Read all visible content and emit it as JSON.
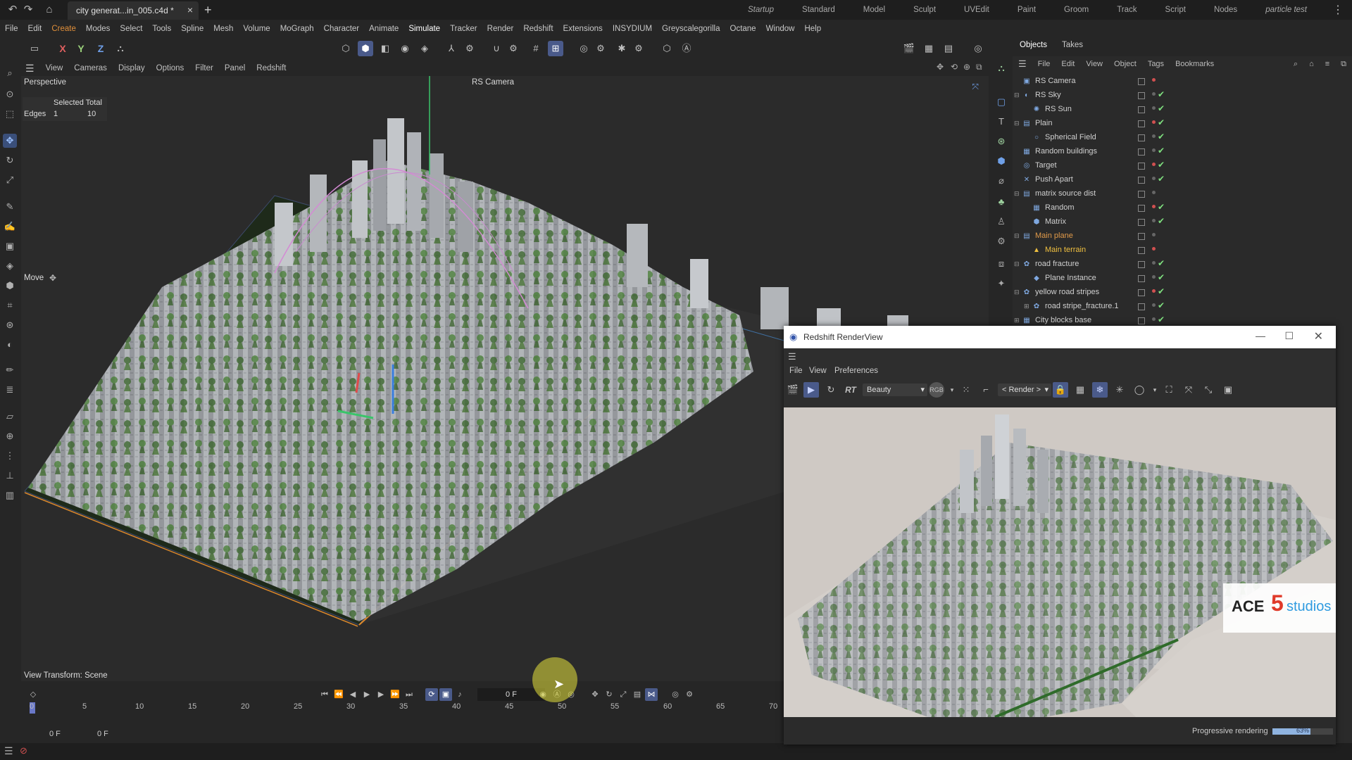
{
  "titlebar": {
    "doc_tab": "city generat...in_005.c4d *",
    "layouts": [
      "Startup",
      "Standard",
      "Model",
      "Sculpt",
      "UVEdit",
      "Paint",
      "Groom",
      "Track",
      "Script",
      "Nodes",
      "particle test"
    ]
  },
  "menubar": [
    "File",
    "Edit",
    "Create",
    "Modes",
    "Select",
    "Tools",
    "Spline",
    "Mesh",
    "Volume",
    "MoGraph",
    "Character",
    "Animate",
    "Simulate",
    "Tracker",
    "Render",
    "Redshift",
    "Extensions",
    "INSYDIUM",
    "Greyscalegorilla",
    "Octane",
    "Window",
    "Help"
  ],
  "cmdbar": {
    "axis_x": "X",
    "axis_y": "Y",
    "axis_z": "Z"
  },
  "viewport": {
    "menu": [
      "View",
      "Cameras",
      "Display",
      "Options",
      "Filter",
      "Panel",
      "Redshift"
    ],
    "name": "Perspective",
    "camera": "RS Camera",
    "hud_header": "Selected Total",
    "hud_row_label": "Edges",
    "hud_selected": "1",
    "hud_total": "10",
    "tool_label": "Move",
    "view_transform": "View Transform: Scene"
  },
  "timeline": {
    "ticks": [
      "0",
      "5",
      "10",
      "15",
      "20",
      "25",
      "30",
      "35",
      "40",
      "45",
      "50",
      "55",
      "60",
      "65",
      "70"
    ],
    "current_frame": "0 F",
    "start_frame": "0 F",
    "min_frame": "0 F"
  },
  "objects_panel": {
    "tabs": [
      "Objects",
      "Takes"
    ],
    "menu": [
      "File",
      "Edit",
      "View",
      "Object",
      "Tags",
      "Bookmarks"
    ],
    "items": [
      {
        "name": "RS Camera",
        "indent": 0,
        "icon": "camera-icon",
        "glyph": "▣",
        "expander": "",
        "style": "",
        "check": false
      },
      {
        "name": "RS Sky",
        "indent": 0,
        "icon": "sky-icon",
        "glyph": "◐",
        "expander": "⊟",
        "style": "",
        "check": true
      },
      {
        "name": "RS Sun",
        "indent": 1,
        "icon": "sun-icon",
        "glyph": "✺",
        "expander": "",
        "style": "",
        "check": true
      },
      {
        "name": "Plain",
        "indent": 0,
        "icon": "effector-icon",
        "glyph": "▤",
        "expander": "⊟",
        "style": "",
        "check": true
      },
      {
        "name": "Spherical Field",
        "indent": 1,
        "icon": "field-icon",
        "glyph": "○",
        "expander": "",
        "style": "",
        "check": true
      },
      {
        "name": "Random buildings",
        "indent": 0,
        "icon": "effector-icon",
        "glyph": "▦",
        "expander": "",
        "style": "",
        "check": true
      },
      {
        "name": "Target",
        "indent": 0,
        "icon": "target-icon",
        "glyph": "◎",
        "expander": "",
        "style": "",
        "check": true
      },
      {
        "name": "Push Apart",
        "indent": 0,
        "icon": "effector-icon",
        "glyph": "✕",
        "expander": "",
        "style": "",
        "check": true
      },
      {
        "name": "matrix source dist",
        "indent": 0,
        "icon": "effector-icon",
        "glyph": "▤",
        "expander": "⊟",
        "style": "",
        "check": false
      },
      {
        "name": "Random",
        "indent": 1,
        "icon": "effector-icon",
        "glyph": "▦",
        "expander": "",
        "style": "",
        "check": true
      },
      {
        "name": "Matrix",
        "indent": 1,
        "icon": "matrix-icon",
        "glyph": "⬢",
        "expander": "",
        "style": "",
        "check": true
      },
      {
        "name": "Main plane",
        "indent": 0,
        "icon": "plane-icon",
        "glyph": "▤",
        "expander": "⊟",
        "style": "orange",
        "check": false
      },
      {
        "name": "Main terrain",
        "indent": 1,
        "icon": "terrain-icon",
        "glyph": "▲",
        "expander": "",
        "style": "yellow",
        "check": false
      },
      {
        "name": "road fracture",
        "indent": 0,
        "icon": "fracture-icon",
        "glyph": "✿",
        "expander": "⊟",
        "style": "",
        "check": true
      },
      {
        "name": "Plane Instance",
        "indent": 1,
        "icon": "instance-icon",
        "glyph": "◆",
        "expander": "",
        "style": "",
        "check": true
      },
      {
        "name": "yellow road stripes",
        "indent": 0,
        "icon": "fracture-icon",
        "glyph": "✿",
        "expander": "⊟",
        "style": "",
        "check": true
      },
      {
        "name": "road stripe_fracture.1",
        "indent": 1,
        "icon": "fracture-icon",
        "glyph": "✿",
        "expander": "⊞",
        "style": "",
        "check": true
      },
      {
        "name": "City blocks base",
        "indent": 0,
        "icon": "cloner-icon",
        "glyph": "▦",
        "expander": "⊞",
        "style": "",
        "check": true
      }
    ]
  },
  "renderview": {
    "title": "Redshift RenderView",
    "menu": [
      "File",
      "View",
      "Preferences"
    ],
    "aov": "Beauty",
    "channel": "RGB",
    "render_mode": "< Render >",
    "status": "Progressive rendering",
    "progress_pct": 63,
    "progress_text": "63%",
    "watermark_pre": "ACE",
    "watermark_num": "5",
    "watermark_post": "studios"
  },
  "colors": {
    "accent": "#e08f3a",
    "active_tool": "#4a5a8a",
    "check": "#7fe07f"
  }
}
